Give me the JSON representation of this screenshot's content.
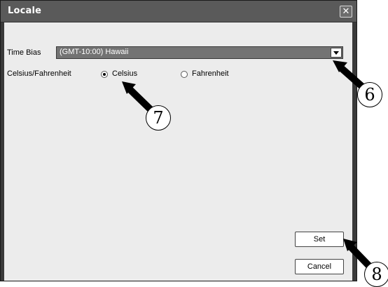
{
  "window": {
    "title": "Locale",
    "close_symbol": "✕"
  },
  "time_bias": {
    "label": "Time Bias",
    "value": "(GMT-10:00) Hawaii"
  },
  "temperature": {
    "label": "Celsius/Fahrenheit",
    "options": [
      {
        "label": "Celsius",
        "selected": true
      },
      {
        "label": "Fahrenheit",
        "selected": false
      }
    ]
  },
  "buttons": {
    "set": "Set",
    "cancel": "Cancel"
  },
  "callouts": [
    "6",
    "7",
    "8"
  ]
}
